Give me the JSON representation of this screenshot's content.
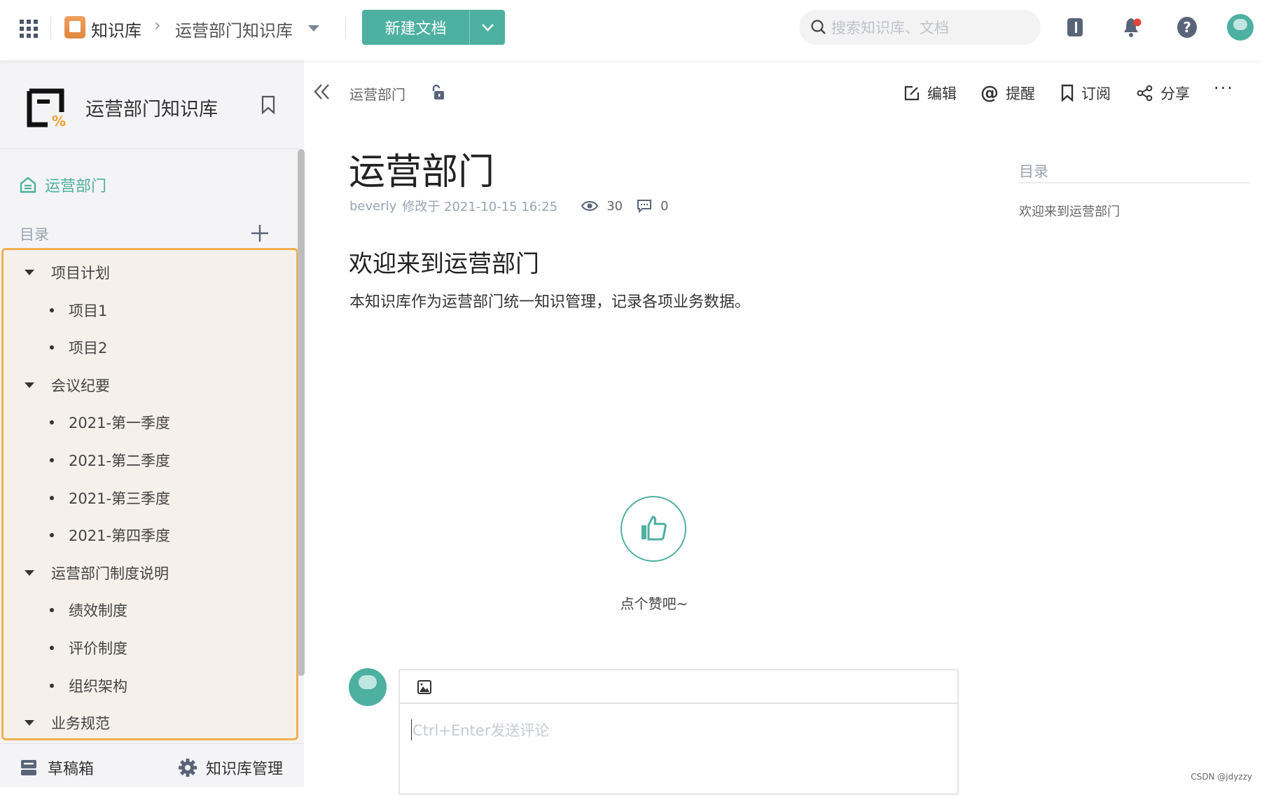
{
  "topbar": {
    "app_label": "知识库",
    "current_library": "运营部门知识库",
    "new_doc_label": "新建文档",
    "search_placeholder": "搜索知识库、文档"
  },
  "sidebar": {
    "library_title": "运营部门知识库",
    "home_item": "运营部门",
    "toc_label": "目录",
    "tree": [
      {
        "label": "项目计划",
        "level": 0
      },
      {
        "label": "项目1",
        "level": 1
      },
      {
        "label": "项目2",
        "level": 1
      },
      {
        "label": "会议纪要",
        "level": 0
      },
      {
        "label": "2021-第一季度",
        "level": 1
      },
      {
        "label": "2021-第二季度",
        "level": 1
      },
      {
        "label": "2021-第三季度",
        "level": 1
      },
      {
        "label": "2021-第四季度",
        "level": 1
      },
      {
        "label": "运营部门制度说明",
        "level": 0
      },
      {
        "label": "绩效制度",
        "level": 1
      },
      {
        "label": "评价制度",
        "level": 1
      },
      {
        "label": "组织架构",
        "level": 1
      },
      {
        "label": "业务规范",
        "level": 0
      }
    ],
    "drafts_label": "草稿箱",
    "manage_label": "知识库管理"
  },
  "doc": {
    "breadcrumb": "运营部门",
    "actions": {
      "edit": "编辑",
      "remind": "提醒",
      "subscribe": "订阅",
      "share": "分享"
    },
    "title": "运营部门",
    "author": "beverly",
    "modified": "修改于 2021-10-15 16:25",
    "views": "30",
    "comments": "0",
    "heading": "欢迎来到运营部门",
    "paragraph": "本知识库作为运营部门统一知识管理，记录各项业务数据。",
    "like_prompt": "点个赞吧~",
    "comment_placeholder": "Ctrl+Enter发送评论"
  },
  "toc": {
    "title": "目录",
    "items": [
      "欢迎来到运营部门"
    ]
  },
  "watermark": "CSDN @jdyzzy",
  "colors": {
    "accent": "#4db0a0",
    "highlight_border": "#f0b050",
    "highlight_bg": "#f5f0ea"
  }
}
